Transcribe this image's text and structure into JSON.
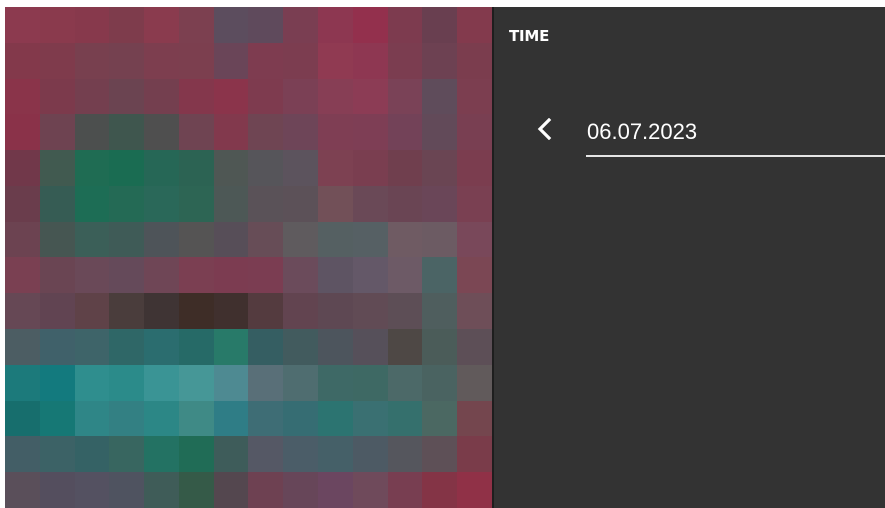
{
  "panel": {
    "title": "TIME"
  },
  "date_picker": {
    "value": "06.07.2023",
    "back_icon": "chevron-left-icon"
  },
  "colors": {
    "panel_background": "#333333",
    "text": "#ffffff",
    "underline": "#e6e6e6",
    "divider": "#1e1e1e"
  },
  "image_preview": {
    "description_icon": "pixelated-image-preview",
    "palette": [
      "#8c3a4f",
      "#8a3a4d",
      "#87394c",
      "#7e3c4c",
      "#8a3b4e",
      "#7c4050",
      "#5c4d5e",
      "#5f4a5c",
      "#7a3e52",
      "#8d3751",
      "#93304d",
      "#7d3b4f",
      "#693f50",
      "#833a4d",
      "#83394b",
      "#7f3b4c",
      "#78404f",
      "#754150",
      "#7d3e4f",
      "#7c3f4f",
      "#6a4558",
      "#7e3c50",
      "#7c3d50",
      "#903a52",
      "#8e3752",
      "#7b3d50",
      "#6d4152",
      "#7b3d4e",
      "#8a344a",
      "#7c3a4c",
      "#743f4f",
      "#6b4451",
      "#743f4f",
      "#84374c",
      "#8b344b",
      "#7e3b4f",
      "#7b4055",
      "#873e55",
      "#8c3c55",
      "#7a4257",
      "#5f4c5b",
      "#7c3e50",
      "#8a3249",
      "#6e4351",
      "#4c4f4e",
      "#3f564e",
      "#4f4f4f",
      "#6f4452",
      "#82394d",
      "#6f4553",
      "#6e4558",
      "#7f3e54",
      "#7e3e55",
      "#734258",
      "#624a59",
      "#793f52",
      "#71384a",
      "#415a50",
      "#1f6c53",
      "#1a6c52",
      "#266756",
      "#2c6353",
      "#4f5754",
      "#56555a",
      "#5c535d",
      "#7d4152",
      "#7a3e50",
      "#703f4e",
      "#6a4553",
      "#7b3d4f",
      "#6a3d4c",
      "#365c54",
      "#1d6d55",
      "#246a55",
      "#2a6859",
      "#2d6554",
      "#4d5856",
      "#5a5258",
      "#5c5158",
      "#725058",
      "#6a4957",
      "#6a4554",
      "#6a4658",
      "#7a4052",
      "#6c4351",
      "#465652",
      "#3b5f58",
      "#3f5b57",
      "#4e5459",
      "#555454",
      "#574e58",
      "#674d57",
      "#5f5b5e",
      "#556062",
      "#566064",
      "#6f5b63",
      "#6c5b63",
      "#79485a",
      "#7a4052",
      "#6a4553",
      "#6a4958",
      "#654a5a",
      "#6f4656",
      "#7b3f52",
      "#7c3c51",
      "#7b3d52",
      "#6b4b5b",
      "#5e5463",
      "#645868",
      "#6d5a66",
      "#4b6465",
      "#7b4754",
      "#664855",
      "#614452",
      "#5f4248",
      "#4a3d3c",
      "#3f3434",
      "#3e2d27",
      "#40302e",
      "#543b3f",
      "#624450",
      "#5e4853",
      "#614b55",
      "#5d4e56",
      "#4f5e5e",
      "#6e4e58",
      "#4c5d63",
      "#40616a",
      "#3e6469",
      "#2f6767",
      "#2b6d6f",
      "#266a67",
      "#287a69",
      "#355e62",
      "#425b5e",
      "#4d555d",
      "#56505a",
      "#4e4845",
      "#4b5c59",
      "#5d4f57",
      "#1c7a7b",
      "#137a7e",
      "#2f8e8e",
      "#2b8b8a",
      "#3a9495",
      "#469797",
      "#4e8a92",
      "#596f78",
      "#4f6d70",
      "#3e6966",
      "#3e6964",
      "#4c6968",
      "#4a6361",
      "#615a5b",
      "#176e6d",
      "#167875",
      "#2f8687",
      "#338083",
      "#2c8786",
      "#3f8a86",
      "#2f7d86",
      "#3e6d75",
      "#366d73",
      "#2c7471",
      "#3a7072",
      "#35706d",
      "#4b6862",
      "#74464e",
      "#435e66",
      "#3c6266",
      "#356265",
      "#386660",
      "#237263",
      "#206c56",
      "#3e5c5a",
      "#555865",
      "#4b5d68",
      "#456068",
      "#4d5a64",
      "#55565d",
      "#5e5057",
      "#7a3c4a",
      "#5a4f5a",
      "#544e5e",
      "#545161",
      "#4f5360",
      "#3f5c58",
      "#355a48",
      "#54474f",
      "#6e4152",
      "#674659",
      "#6b4660",
      "#6f4a5b",
      "#783e51",
      "#843446",
      "#903147"
    ]
  }
}
